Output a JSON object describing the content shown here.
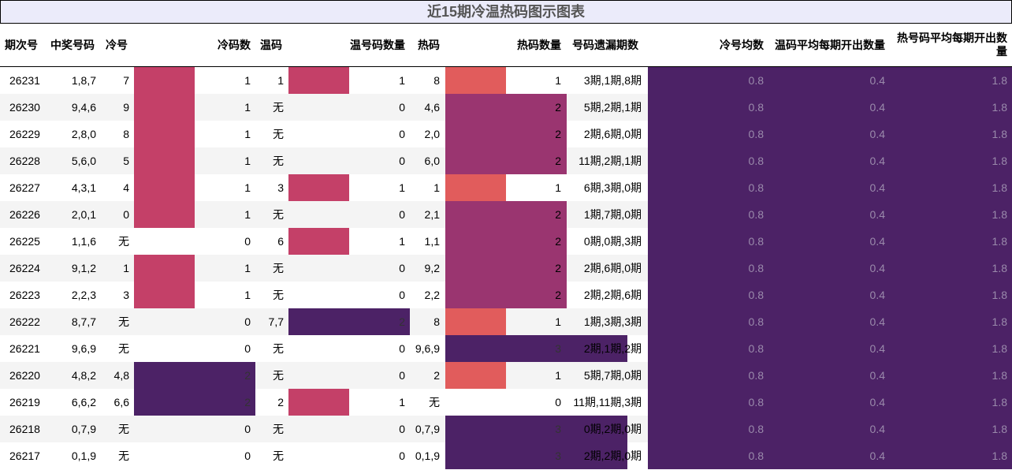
{
  "title": "近15期冷温热码图示图表",
  "headers": {
    "issue": "期次号",
    "winning": "中奖号码",
    "cold": "冷号",
    "cold_count": "冷码数",
    "warm": "温码",
    "warm_count": "温号码数量",
    "hot": "热码",
    "hot_count": "热码数量",
    "missing": "号码遗漏期数",
    "cold_avg": "冷号均数",
    "warm_avg": "温码平均每期开出数量",
    "hot_avg_line1": "热号码平均每期开出数",
    "hot_avg_line2": "量"
  },
  "colors": {
    "count1_cold_warm": "#c44068",
    "count2_warm": "#4c2266",
    "count1_hot": "#e15c5c",
    "count2_hot": "#9a3570",
    "count3": "#4c2266",
    "avg_bg": "#4c2266",
    "row_odd": "#f4f4f4",
    "row_even": "#ffffff"
  },
  "chart_data": {
    "type": "table",
    "title": "近15期冷温热码图示图表",
    "columns": [
      "期次号",
      "中奖号码",
      "冷号",
      "冷码数",
      "温码",
      "温号码数量",
      "热码",
      "热码数量",
      "号码遗漏期数",
      "冷号均数",
      "温码平均每期开出数量",
      "热号码平均每期开出数量"
    ],
    "rows": [
      {
        "issue": "26231",
        "winning": "1,8,7",
        "cold": "7",
        "cold_count": 1,
        "warm": "1",
        "warm_count": 1,
        "hot": "8",
        "hot_count": 1,
        "missing": "3期,1期,8期",
        "cold_avg": "0.8",
        "warm_avg": "0.4",
        "hot_avg": "1.8"
      },
      {
        "issue": "26230",
        "winning": "9,4,6",
        "cold": "9",
        "cold_count": 1,
        "warm": "无",
        "warm_count": 0,
        "hot": "4,6",
        "hot_count": 2,
        "missing": "5期,2期,1期",
        "cold_avg": "0.8",
        "warm_avg": "0.4",
        "hot_avg": "1.8"
      },
      {
        "issue": "26229",
        "winning": "2,8,0",
        "cold": "8",
        "cold_count": 1,
        "warm": "无",
        "warm_count": 0,
        "hot": "2,0",
        "hot_count": 2,
        "missing": "2期,6期,0期",
        "cold_avg": "0.8",
        "warm_avg": "0.4",
        "hot_avg": "1.8"
      },
      {
        "issue": "26228",
        "winning": "5,6,0",
        "cold": "5",
        "cold_count": 1,
        "warm": "无",
        "warm_count": 0,
        "hot": "6,0",
        "hot_count": 2,
        "missing": "11期,2期,1期",
        "cold_avg": "0.8",
        "warm_avg": "0.4",
        "hot_avg": "1.8"
      },
      {
        "issue": "26227",
        "winning": "4,3,1",
        "cold": "4",
        "cold_count": 1,
        "warm": "3",
        "warm_count": 1,
        "hot": "1",
        "hot_count": 1,
        "missing": "6期,3期,0期",
        "cold_avg": "0.8",
        "warm_avg": "0.4",
        "hot_avg": "1.8"
      },
      {
        "issue": "26226",
        "winning": "2,0,1",
        "cold": "0",
        "cold_count": 1,
        "warm": "无",
        "warm_count": 0,
        "hot": "2,1",
        "hot_count": 2,
        "missing": "1期,7期,0期",
        "cold_avg": "0.8",
        "warm_avg": "0.4",
        "hot_avg": "1.8"
      },
      {
        "issue": "26225",
        "winning": "1,1,6",
        "cold": "无",
        "cold_count": 0,
        "warm": "6",
        "warm_count": 1,
        "hot": "1,1",
        "hot_count": 2,
        "missing": "0期,0期,3期",
        "cold_avg": "0.8",
        "warm_avg": "0.4",
        "hot_avg": "1.8"
      },
      {
        "issue": "26224",
        "winning": "9,1,2",
        "cold": "1",
        "cold_count": 1,
        "warm": "无",
        "warm_count": 0,
        "hot": "9,2",
        "hot_count": 2,
        "missing": "2期,6期,0期",
        "cold_avg": "0.8",
        "warm_avg": "0.4",
        "hot_avg": "1.8"
      },
      {
        "issue": "26223",
        "winning": "2,2,3",
        "cold": "3",
        "cold_count": 1,
        "warm": "无",
        "warm_count": 0,
        "hot": "2,2",
        "hot_count": 2,
        "missing": "2期,2期,6期",
        "cold_avg": "0.8",
        "warm_avg": "0.4",
        "hot_avg": "1.8"
      },
      {
        "issue": "26222",
        "winning": "8,7,7",
        "cold": "无",
        "cold_count": 0,
        "warm": "7,7",
        "warm_count": 2,
        "hot": "8",
        "hot_count": 1,
        "missing": "1期,3期,3期",
        "cold_avg": "0.8",
        "warm_avg": "0.4",
        "hot_avg": "1.8"
      },
      {
        "issue": "26221",
        "winning": "9,6,9",
        "cold": "无",
        "cold_count": 0,
        "warm": "无",
        "warm_count": 0,
        "hot": "9,6,9",
        "hot_count": 3,
        "missing": "2期,1期,2期",
        "cold_avg": "0.8",
        "warm_avg": "0.4",
        "hot_avg": "1.8"
      },
      {
        "issue": "26220",
        "winning": "4,8,2",
        "cold": "4,8",
        "cold_count": 2,
        "warm": "无",
        "warm_count": 0,
        "hot": "2",
        "hot_count": 1,
        "missing": "5期,7期,0期",
        "cold_avg": "0.8",
        "warm_avg": "0.4",
        "hot_avg": "1.8"
      },
      {
        "issue": "26219",
        "winning": "6,6,2",
        "cold": "6,6",
        "cold_count": 2,
        "warm": "2",
        "warm_count": 1,
        "hot": "无",
        "hot_count": 0,
        "missing": "11期,11期,3期",
        "cold_avg": "0.8",
        "warm_avg": "0.4",
        "hot_avg": "1.8"
      },
      {
        "issue": "26218",
        "winning": "0,7,9",
        "cold": "无",
        "cold_count": 0,
        "warm": "无",
        "warm_count": 0,
        "hot": "0,7,9",
        "hot_count": 3,
        "missing": "0期,2期,0期",
        "cold_avg": "0.8",
        "warm_avg": "0.4",
        "hot_avg": "1.8"
      },
      {
        "issue": "26217",
        "winning": "0,1,9",
        "cold": "无",
        "cold_count": 0,
        "warm": "无",
        "warm_count": 0,
        "hot": "0,1,9",
        "hot_count": 3,
        "missing": "2期,2期,0期",
        "cold_avg": "0.8",
        "warm_avg": "0.4",
        "hot_avg": "1.8"
      }
    ]
  }
}
